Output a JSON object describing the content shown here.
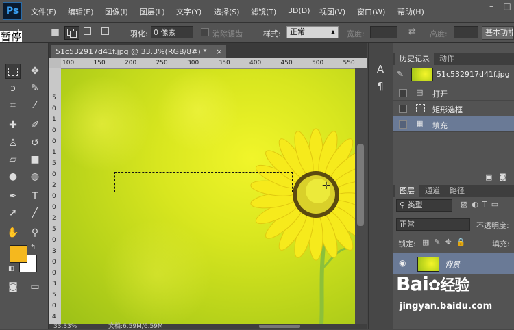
{
  "app": {
    "logo": "Ps"
  },
  "menu": [
    "文件(F)",
    "编辑(E)",
    "图像(I)",
    "图层(L)",
    "文字(Y)",
    "选择(S)",
    "滤镜(T)",
    "3D(D)",
    "视图(V)",
    "窗口(W)",
    "帮助(H)"
  ],
  "window_controls": [
    "–",
    "□"
  ],
  "options": {
    "pause_label": "暂停",
    "feather_label": "羽化:",
    "feather_value": "0 像素",
    "antialias_label": "消除锯齿",
    "style_label": "样式:",
    "style_value": "正常",
    "width_label": "宽度:",
    "height_label": "高度:",
    "refine_button": "基本功能"
  },
  "document": {
    "tab_title": "51c532917d41f.jpg @ 33.3%(RGB/8#) *",
    "tab_close": "×",
    "ruler_h": [
      "100",
      "150",
      "200",
      "250",
      "300",
      "350",
      "400",
      "450",
      "500",
      "550"
    ],
    "ruler_v": [
      "5",
      "0",
      "1",
      "0",
      "0",
      "1",
      "5",
      "0",
      "2",
      "0",
      "0",
      "2",
      "5",
      "0",
      "3",
      "0",
      "0",
      "3",
      "5",
      "0",
      "4",
      "0"
    ],
    "zoom": "33.33%",
    "doc_size": "文档:6.59M/6.59M"
  },
  "history": {
    "tabs": [
      "历史记录",
      "动作"
    ],
    "snapshot_name": "51c532917d41f.jpg",
    "items": [
      {
        "label": "打开",
        "icon": "document-icon"
      },
      {
        "label": "矩形选框",
        "icon": "marquee-icon"
      },
      {
        "label": "填充",
        "icon": "fill-icon"
      }
    ]
  },
  "layers": {
    "tabs": [
      "图层",
      "通道",
      "路径"
    ],
    "filter_label": "类型",
    "blend_mode": "正常",
    "opacity_label": "不透明度:",
    "lock_label": "锁定:",
    "fill_label": "填充:",
    "layer_name": "背景"
  },
  "watermark": {
    "brand": "Bai",
    "brand_suffix": "经验",
    "url": "jingyan.baidu.com"
  },
  "colors": {
    "foreground": "#f5b81e",
    "background": "#ffffff",
    "selection": "#6a7a96"
  }
}
